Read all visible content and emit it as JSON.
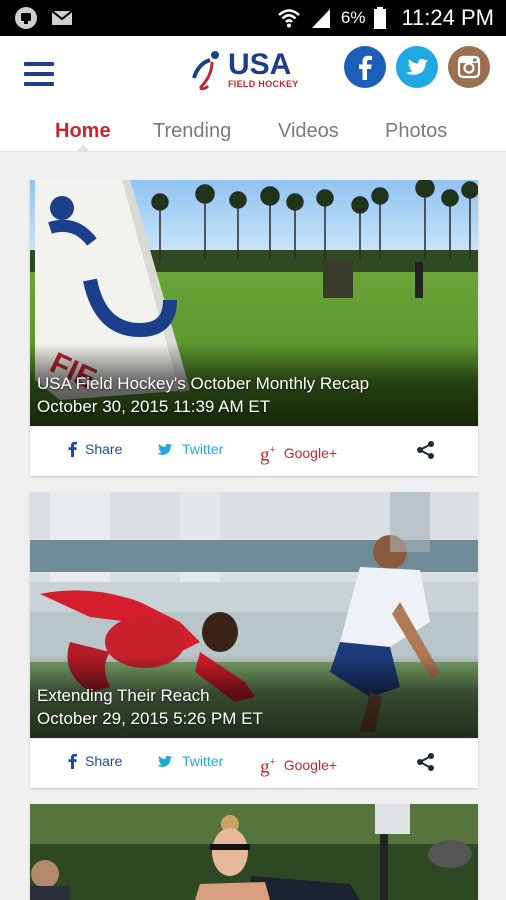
{
  "status_bar": {
    "battery_percent": "6%",
    "time": "11:24 PM",
    "left_icons": [
      "notification-icon",
      "mail-icon"
    ],
    "right_icons": [
      "wifi-icon",
      "signal-icon",
      "battery-icon"
    ]
  },
  "header": {
    "logo": {
      "word": "USA",
      "subtitle": "FIELD HOCKEY"
    },
    "menu_icon": "hamburger-icon",
    "social": [
      {
        "name": "facebook",
        "icon": "facebook-icon",
        "color": "#1c5fb7"
      },
      {
        "name": "twitter",
        "icon": "twitter-icon",
        "color": "#1ea9e1"
      },
      {
        "name": "instagram",
        "icon": "instagram-icon",
        "color": "#9a7050"
      }
    ]
  },
  "tabs": [
    {
      "label": "Home",
      "active": true
    },
    {
      "label": "Trending",
      "active": false
    },
    {
      "label": "Videos",
      "active": false
    },
    {
      "label": "Photos",
      "active": false
    }
  ],
  "colors": {
    "accent": "#c8262d",
    "brand_blue": "#1c3f8c",
    "twitter": "#1ea9e1"
  },
  "action_labels": {
    "share": "Share",
    "twitter": "Twitter",
    "google": "Google+"
  },
  "articles": [
    {
      "title": "USA Field Hockey's October Monthly Recap",
      "date": "October 30, 2015 11:39 AM ET"
    },
    {
      "title": "Extending Their Reach",
      "date": "October 29, 2015 5:26 PM ET"
    },
    {
      "title": "",
      "date": ""
    }
  ]
}
